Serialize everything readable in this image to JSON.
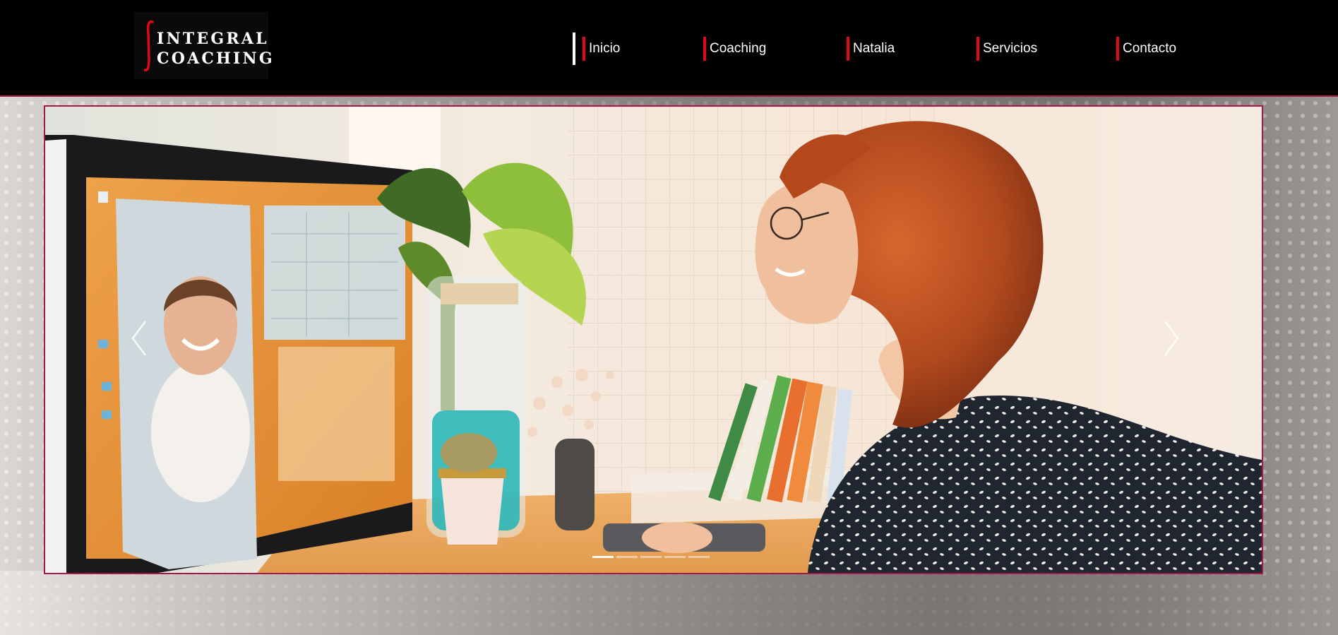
{
  "brand": {
    "line1": "INTEGRAL",
    "line2": "COACHING",
    "accent_color": "#e0091b",
    "border_color": "#a8174a"
  },
  "nav": {
    "items": [
      {
        "label": "Inicio",
        "active": true
      },
      {
        "label": "Coaching",
        "active": false
      },
      {
        "label": "Natalia",
        "active": false
      },
      {
        "label": "Servicios",
        "active": false
      },
      {
        "label": "Contacto",
        "active": false
      }
    ]
  },
  "slider": {
    "prev_icon": "chevron-left-icon",
    "next_icon": "chevron-right-icon",
    "slide_count": 5,
    "active_slide": 1
  }
}
